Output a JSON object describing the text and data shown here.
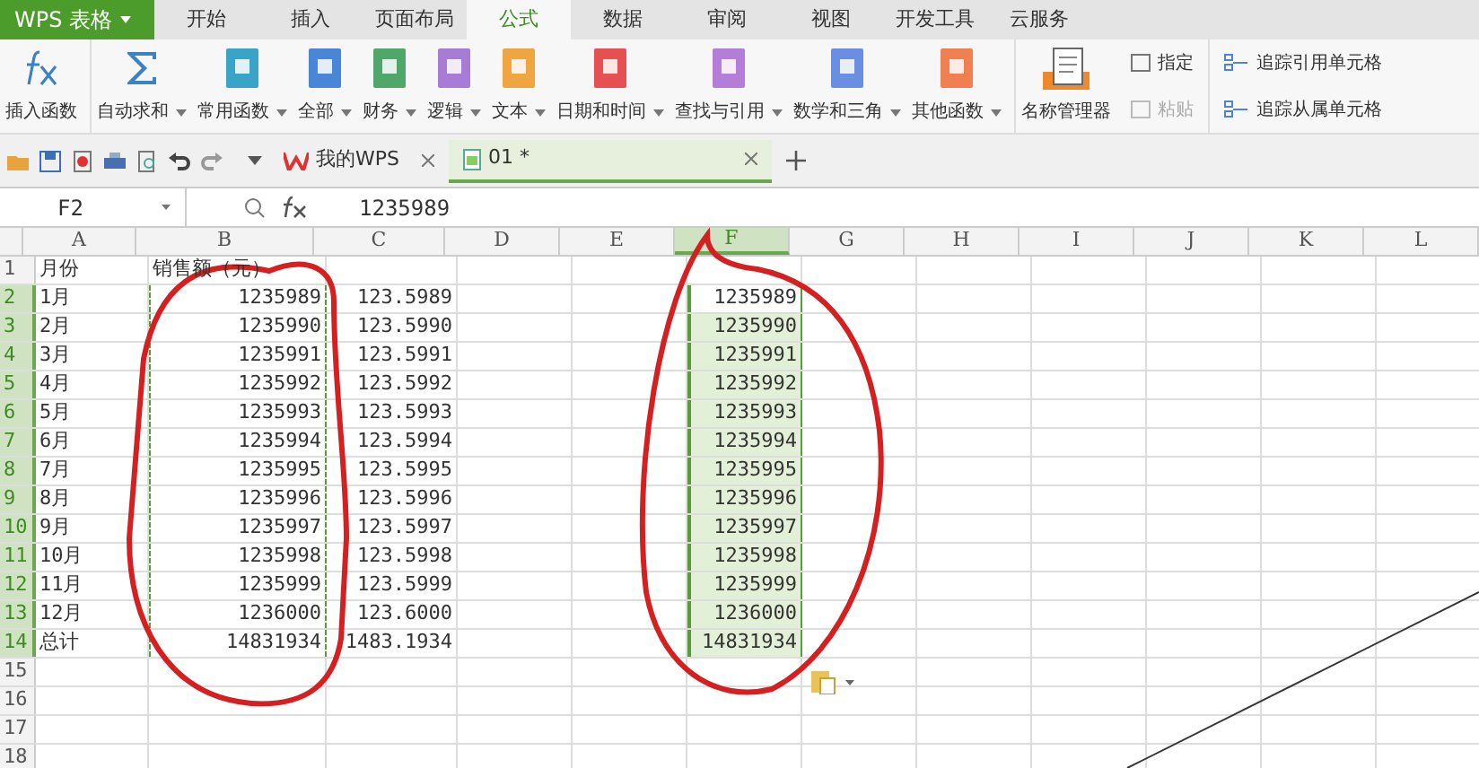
{
  "app_menu": {
    "label": "WPS 表格"
  },
  "tabs": [
    {
      "label": "开始",
      "selected": false
    },
    {
      "label": "插入",
      "selected": false
    },
    {
      "label": "页面布局",
      "selected": false
    },
    {
      "label": "公式",
      "selected": true
    },
    {
      "label": "数据",
      "selected": false
    },
    {
      "label": "审阅",
      "selected": false
    },
    {
      "label": "视图",
      "selected": false
    },
    {
      "label": "开发工具",
      "selected": false
    },
    {
      "label": "云服务",
      "selected": false
    }
  ],
  "ribbon": [
    {
      "kind": "fx",
      "label": "插入函数",
      "dropdown": false
    },
    {
      "kind": "sigma",
      "label": "自动求和",
      "dropdown": true
    },
    {
      "kind": "book",
      "label": "常用函数",
      "dropdown": true,
      "color": "#3aa3c8"
    },
    {
      "kind": "book",
      "label": "全部",
      "dropdown": true,
      "color": "#4a86d8"
    },
    {
      "kind": "book",
      "label": "财务",
      "dropdown": true,
      "color": "#4fa86a"
    },
    {
      "kind": "book",
      "label": "逻辑",
      "dropdown": true,
      "color": "#a77bd6"
    },
    {
      "kind": "book",
      "label": "文本",
      "dropdown": true,
      "color": "#f0a640"
    },
    {
      "kind": "book",
      "label": "日期和时间",
      "dropdown": true,
      "color": "#e65050"
    },
    {
      "kind": "book",
      "label": "查找与引用",
      "dropdown": true,
      "color": "#b47ed8"
    },
    {
      "kind": "book",
      "label": "数学和三角",
      "dropdown": true,
      "color": "#6a8ee0"
    },
    {
      "kind": "book",
      "label": "其他函数",
      "dropdown": true,
      "color": "#f08050"
    },
    {
      "kind": "names",
      "label": "名称管理器",
      "dropdown": false
    }
  ],
  "ribbon_small": [
    {
      "label": "指定",
      "disabled": false
    },
    {
      "label": "粘贴",
      "disabled": true
    }
  ],
  "ribbon_trace": [
    {
      "label": "追踪引用单元格"
    },
    {
      "label": "追踪从属单元格"
    }
  ],
  "doc_tabs": [
    {
      "label": "我的WPS",
      "kind": "home",
      "selected": false
    },
    {
      "label": "01 *",
      "kind": "sheet",
      "selected": true
    }
  ],
  "name_box": {
    "value": "F2"
  },
  "formula": {
    "value": "1235989"
  },
  "columns": [
    {
      "label": "A",
      "selected": false
    },
    {
      "label": "B",
      "selected": false
    },
    {
      "label": "C",
      "selected": false
    },
    {
      "label": "D",
      "selected": false
    },
    {
      "label": "E",
      "selected": false
    },
    {
      "label": "F",
      "selected": true
    },
    {
      "label": "G",
      "selected": false
    },
    {
      "label": "H",
      "selected": false
    },
    {
      "label": "I",
      "selected": false
    },
    {
      "label": "J",
      "selected": false
    },
    {
      "label": "K",
      "selected": false
    },
    {
      "label": "L",
      "selected": false
    }
  ],
  "rows": [
    {
      "number": "1",
      "kind": "header",
      "selected": false,
      "a": "月份",
      "b": "销售额（元）"
    },
    {
      "number": "2",
      "kind": "data",
      "selected": true,
      "a": "1月",
      "b": "1235989",
      "c": "123.5989",
      "f": "1235989"
    },
    {
      "number": "3",
      "kind": "data",
      "selected": true,
      "a": "2月",
      "b": "1235990",
      "c": "123.5990",
      "f": "1235990"
    },
    {
      "number": "4",
      "kind": "data",
      "selected": true,
      "a": "3月",
      "b": "1235991",
      "c": "123.5991",
      "f": "1235991"
    },
    {
      "number": "5",
      "kind": "data",
      "selected": true,
      "a": "4月",
      "b": "1235992",
      "c": "123.5992",
      "f": "1235992"
    },
    {
      "number": "6",
      "kind": "data",
      "selected": true,
      "a": "5月",
      "b": "1235993",
      "c": "123.5993",
      "f": "1235993"
    },
    {
      "number": "7",
      "kind": "data",
      "selected": true,
      "a": "6月",
      "b": "1235994",
      "c": "123.5994",
      "f": "1235994"
    },
    {
      "number": "8",
      "kind": "data",
      "selected": true,
      "a": "7月",
      "b": "1235995",
      "c": "123.5995",
      "f": "1235995"
    },
    {
      "number": "9",
      "kind": "data",
      "selected": true,
      "a": "8月",
      "b": "1235996",
      "c": "123.5996",
      "f": "1235996"
    },
    {
      "number": "10",
      "kind": "data",
      "selected": true,
      "a": "9月",
      "b": "1235997",
      "c": "123.5997",
      "f": "1235997"
    },
    {
      "number": "11",
      "kind": "data",
      "selected": true,
      "a": "10月",
      "b": "1235998",
      "c": "123.5998",
      "f": "1235998"
    },
    {
      "number": "12",
      "kind": "data",
      "selected": true,
      "a": "11月",
      "b": "1235999",
      "c": "123.5999",
      "f": "1235999"
    },
    {
      "number": "13",
      "kind": "data",
      "selected": true,
      "a": "12月",
      "b": "1236000",
      "c": "123.6000",
      "f": "1236000"
    },
    {
      "number": "14",
      "kind": "data",
      "selected": true,
      "a": "总计",
      "b": "14831934",
      "c": "1483.1934",
      "f": "14831934"
    },
    {
      "number": "15",
      "kind": "empty",
      "selected": false
    },
    {
      "number": "16",
      "kind": "empty",
      "selected": false
    },
    {
      "number": "17",
      "kind": "empty",
      "selected": false
    },
    {
      "number": "18",
      "kind": "empty",
      "selected": false
    }
  ]
}
